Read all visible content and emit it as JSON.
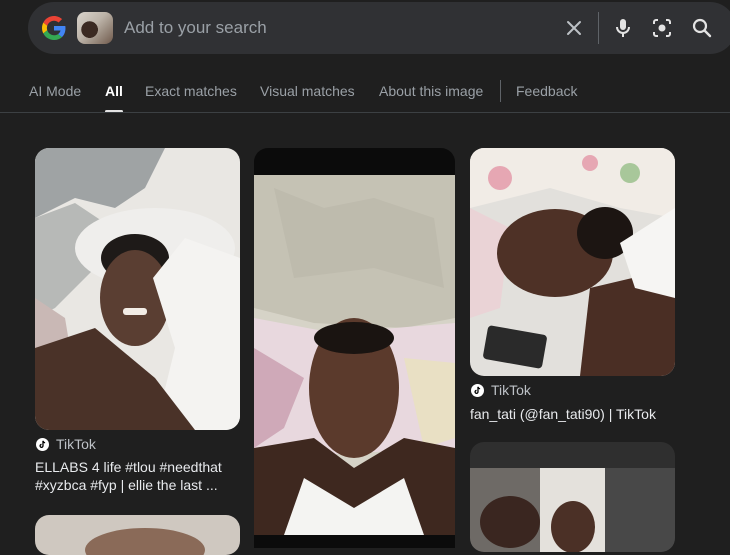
{
  "search": {
    "placeholder": "Add to your search",
    "value": ""
  },
  "icons": {
    "logo": "google-g-logo",
    "clear": "close-icon",
    "voice": "mic-icon",
    "lens": "lens-camera-icon",
    "search": "search-icon"
  },
  "tabs": [
    {
      "label": "AI Mode"
    },
    {
      "label": "All",
      "active": true
    },
    {
      "label": "Exact matches"
    },
    {
      "label": "Visual matches"
    },
    {
      "label": "About this image"
    },
    {
      "label": "Feedback"
    }
  ],
  "results": [
    {
      "source": "TikTok",
      "title_line1": "ELLABS 4 life #tlou #needthat",
      "title_line2": "#xyzbca #fyp | ellie the last ..."
    },
    {
      "source": "TikTok",
      "title": "fan_tati (@fan_tati90) | TikTok"
    }
  ],
  "colors": {
    "background": "#1f1f1f",
    "searchbar": "#303134",
    "accent": "#ffffff"
  }
}
